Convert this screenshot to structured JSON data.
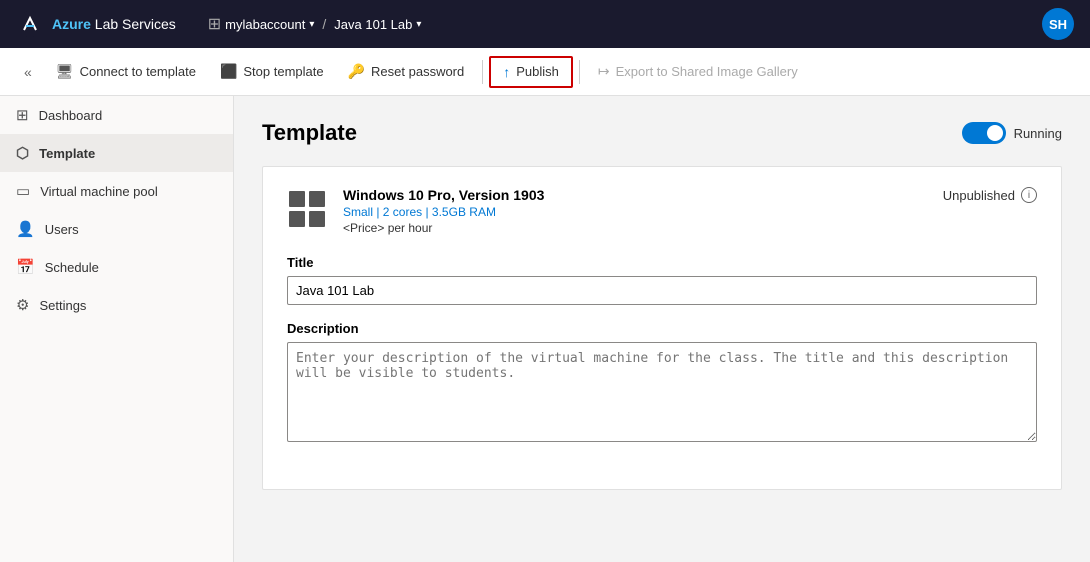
{
  "topbar": {
    "logo_text_azure": "Azure",
    "logo_text_service": " Lab Services",
    "account_name": "mylabaccount",
    "separator": "/",
    "lab_name": "Java 101 Lab",
    "avatar_initials": "SH"
  },
  "toolbar": {
    "collapse_icon": "«",
    "connect_label": "Connect to template",
    "stop_label": "Stop template",
    "reset_label": "Reset password",
    "publish_label": "Publish",
    "export_label": "Export to Shared Image Gallery"
  },
  "sidebar": {
    "items": [
      {
        "id": "dashboard",
        "label": "Dashboard",
        "icon": "⊞"
      },
      {
        "id": "template",
        "label": "Template",
        "icon": "⬡"
      },
      {
        "id": "vm-pool",
        "label": "Virtual machine pool",
        "icon": "▭"
      },
      {
        "id": "users",
        "label": "Users",
        "icon": "👤"
      },
      {
        "id": "schedule",
        "label": "Schedule",
        "icon": "📅"
      },
      {
        "id": "settings",
        "label": "Settings",
        "icon": "⚙"
      }
    ]
  },
  "main": {
    "title": "Template",
    "toggle_state": "Running",
    "card": {
      "vm_name": "Windows 10 Pro, Version 1903",
      "vm_spec": "Small | 2 cores | 3.5GB RAM",
      "vm_price": "<Price> per hour",
      "status": "Unpublished",
      "title_label": "Title",
      "title_value": "Java 101 Lab",
      "description_label": "Description",
      "description_placeholder": "Enter your description of the virtual machine for the class. The title and this description will be visible to students."
    }
  }
}
